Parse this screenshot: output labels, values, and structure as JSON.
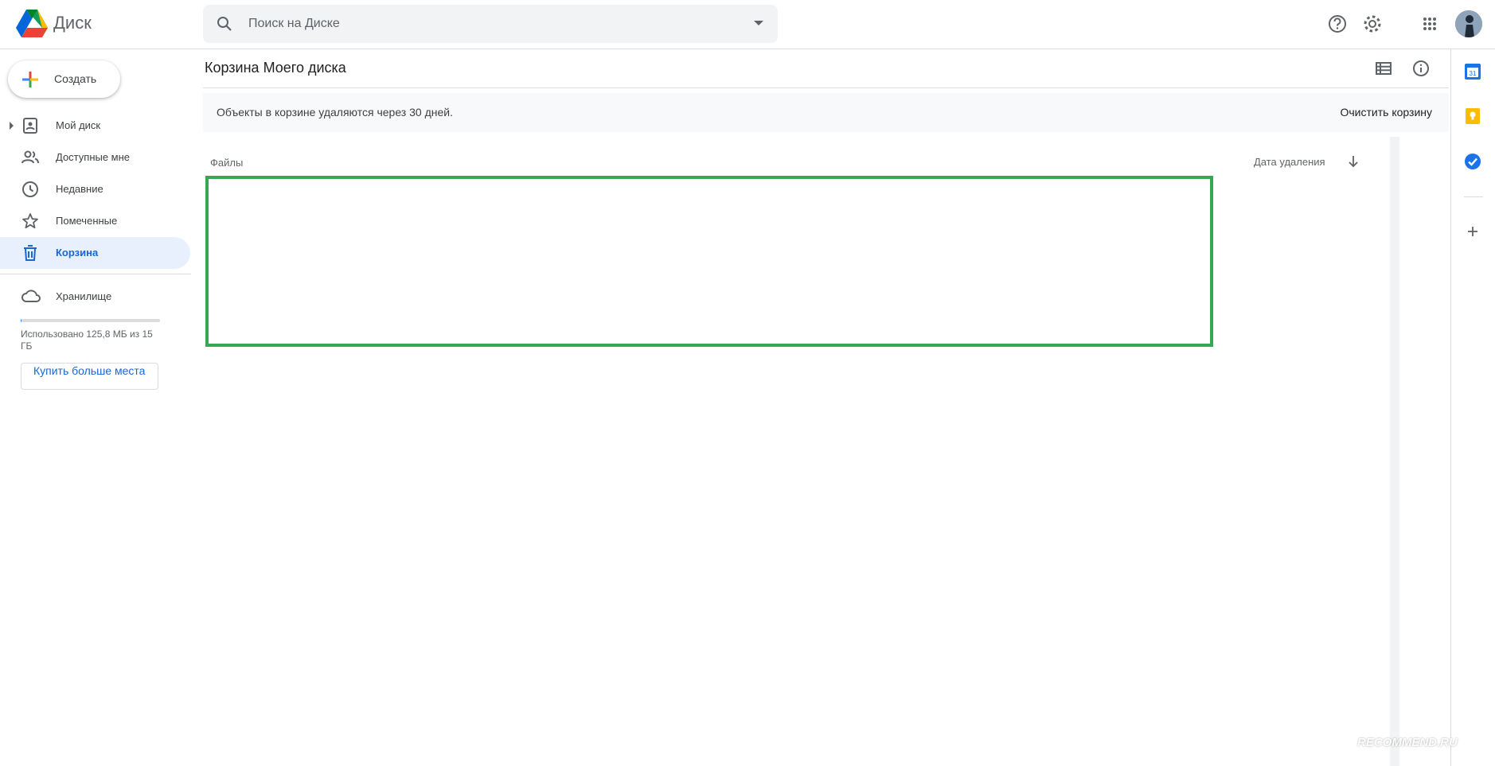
{
  "app": {
    "title": "Диск"
  },
  "search": {
    "placeholder": "Поиск на Диске"
  },
  "header": {
    "icons": [
      "help-icon",
      "settings-icon",
      "apps-grid-icon",
      "avatar"
    ]
  },
  "sidebar": {
    "create_label": "Создать",
    "items": [
      {
        "label": "Мой диск",
        "icon": "my-drive-icon"
      },
      {
        "label": "Доступные мне",
        "icon": "shared-with-me-icon"
      },
      {
        "label": "Недавние",
        "icon": "recent-clock-icon"
      },
      {
        "label": "Помеченные",
        "icon": "star-icon"
      },
      {
        "label": "Корзина",
        "icon": "trash-icon",
        "active": true
      }
    ],
    "storage": {
      "label": "Хранилище",
      "used_text": "Использовано 125,8 МБ из 15 ГБ",
      "used_fraction": 0.008,
      "buy_label": "Купить больше места"
    }
  },
  "main": {
    "title": "Корзина Моего диска",
    "banner_text": "Объекты в корзине удаляются через 30 дней.",
    "empty_trash_label": "Очистить корзину",
    "columns": {
      "files": "Файлы",
      "date_deleted": "Дата удаления"
    },
    "highlight_color": "#34a853"
  },
  "right_panel": {
    "icons": [
      "calendar-icon",
      "keep-icon",
      "tasks-icon",
      "add-addon-icon"
    ]
  },
  "watermark": "RECOMMEND.RU",
  "colors": {
    "accent": "#1a73e8",
    "active_bg": "#e8f0fe",
    "active_text": "#1967d2"
  }
}
